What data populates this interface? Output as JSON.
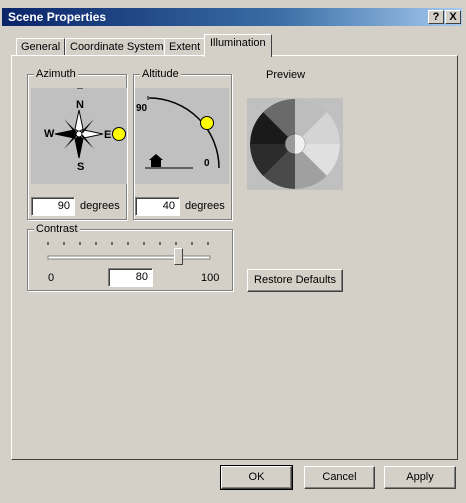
{
  "window": {
    "title": "Scene Properties",
    "help_btn": "?",
    "close_btn": "X"
  },
  "tabs": [
    "General",
    "Coordinate System",
    "Extent",
    "Illumination"
  ],
  "azimuth": {
    "label": "Azimuth",
    "compass": {
      "n": "N",
      "s": "S",
      "e": "E",
      "w": "W"
    },
    "value": "90",
    "unit": "degrees"
  },
  "altitude": {
    "label": "Altitude",
    "top_label": "90",
    "bottom_label": "0",
    "value": "40",
    "unit": "degrees"
  },
  "preview": {
    "label": "Preview"
  },
  "contrast": {
    "label": "Contrast",
    "min": "0",
    "value": "80",
    "max": "100",
    "slider_fraction": 0.8
  },
  "buttons": {
    "restore": "Restore Defaults",
    "ok": "OK",
    "cancel": "Cancel",
    "apply": "Apply"
  },
  "colors": {
    "sun": "#ffff00",
    "titlebar": "#0a246a"
  }
}
